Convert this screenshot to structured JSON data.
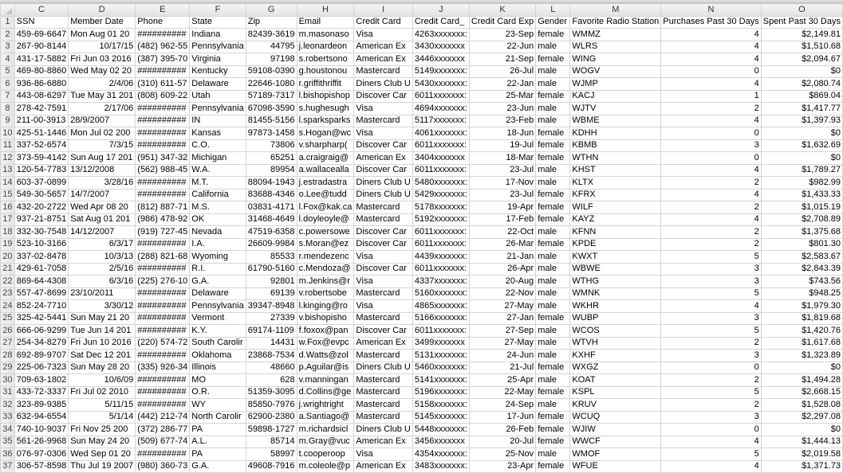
{
  "sheet": {
    "column_letters": [
      "C",
      "D",
      "E",
      "F",
      "G",
      "H",
      "I",
      "J",
      "K",
      "L",
      "M",
      "N",
      "O"
    ],
    "header_row": [
      "SSN",
      "Member Date",
      "Phone",
      "State",
      "Zip",
      "Email",
      "Credit Card",
      "Credit Card_",
      "Credit Card Exp",
      "Gender",
      "Favorite Radio Station",
      "Purchases Past 30 Days",
      "Spent Past 30 Days"
    ],
    "rows": [
      [
        "459-69-6647",
        "Mon Aug 01 20",
        "##########",
        "Indiana",
        "82439-3619",
        "m.masonaso",
        "Visa",
        "4263xxxxxxx:",
        "23-Sep",
        "female",
        "WMMZ",
        "4",
        "$2,149.81"
      ],
      [
        "267-90-8144",
        "10/17/15",
        "(482) 962-55",
        "Pennsylvania",
        "44795",
        "j.leonardeon",
        "American Ex",
        "3430xxxxxxx",
        "22-Jun",
        "male",
        "WLRS",
        "4",
        "$1,510.68"
      ],
      [
        "431-17-5882",
        "Fri Jun 03 2016",
        "(387) 395-70",
        "Virginia",
        "97198",
        "s.robertsono",
        "American Ex",
        "3446xxxxxxx",
        "21-Sep",
        "female",
        "WING",
        "4",
        "$2,094.67"
      ],
      [
        "469-80-8860",
        "Wed May 02 20",
        "##########",
        "Kentucky",
        "59108-0390",
        "g.houstonou",
        "Mastercard",
        "5149xxxxxxx:",
        "26-Jul",
        "male",
        "WOGV",
        "0",
        "$0"
      ],
      [
        "936-86-6880",
        "2/4/06",
        "(310) 611-57",
        "Delaware",
        "22646-1080",
        "r.griffithriffit",
        "Diners Club U",
        "5430xxxxxxx:",
        "22-Jan",
        "male",
        "WJMP",
        "4",
        "$2,080.74"
      ],
      [
        "443-08-6297",
        "Tue May 31 201",
        "(808) 609-22",
        "Utah",
        "57189-7317",
        "l.bishopishop",
        "Discover Car",
        "6011xxxxxxx:",
        "25-Mar",
        "female",
        "KACJ",
        "1",
        "$869.04"
      ],
      [
        "278-42-7591",
        "2/17/06",
        "##########",
        "Pennsylvania",
        "67098-3590",
        "s.hughesugh",
        "Visa",
        "4694xxxxxxx:",
        "23-Jun",
        "male",
        "WJTV",
        "2",
        "$1,417.77"
      ],
      [
        "211-00-3913",
        "28/9/2007",
        "##########",
        "IN",
        "81455-5156",
        "l.sparksparks",
        "Mastercard",
        "5117xxxxxxx:",
        "23-Feb",
        "male",
        "WBME",
        "4",
        "$1,397.93"
      ],
      [
        "425-51-1446",
        "Mon Jul 02 200",
        "##########",
        "Kansas",
        "97873-1458",
        "s.Hogan@wc",
        "Visa",
        "4061xxxxxxx:",
        "18-Jun",
        "female",
        "KDHH",
        "0",
        "$0"
      ],
      [
        "337-52-6574",
        "7/3/15",
        "##########",
        "C.O.",
        "73806",
        "v.sharpharp(",
        "Discover Car",
        "6011xxxxxxx:",
        "19-Jul",
        "female",
        "KBMB",
        "3",
        "$1,632.69"
      ],
      [
        "373-59-4142",
        "Sun Aug 17 201",
        "(951) 347-32",
        "Michigan",
        "65251",
        "a.craigraig@",
        "American Ex",
        "3404xxxxxxx",
        "18-Mar",
        "female",
        "WTHN",
        "0",
        "$0"
      ],
      [
        "120-54-7783",
        "13/12/2008",
        "(562) 988-45",
        "W.A.",
        "89954",
        "a.wallacealla",
        "Discover Car",
        "6011xxxxxxx:",
        "23-Jul",
        "male",
        "KHST",
        "4",
        "$1,789.27"
      ],
      [
        "603-37-0899",
        "3/28/16",
        "##########",
        "M.T.",
        "88094-1943",
        "j.estradastra",
        "Diners Club U",
        "5480xxxxxxx:",
        "17-Nov",
        "male",
        "KLTX",
        "2",
        "$982.99"
      ],
      [
        "549-30-5657",
        "14/7/2007",
        "##########",
        "California",
        "83688-4346",
        "o.Lee@tudd",
        "Diners Club U",
        "5429xxxxxxx:",
        "23-Jul",
        "female",
        "KFRX",
        "4",
        "$1,433.33"
      ],
      [
        "432-20-2722",
        "Wed Apr 08 20",
        "(812) 887-71",
        "M.S.",
        "03831-4171",
        "l.Fox@kak.ca",
        "Mastercard",
        "5178xxxxxxx:",
        "19-Apr",
        "female",
        "WILF",
        "2",
        "$1,015.19"
      ],
      [
        "937-21-8751",
        "Sat Aug 01 201",
        "(986) 478-92",
        "OK",
        "31468-4649",
        "l.doyleoyle@",
        "Mastercard",
        "5192xxxxxxx:",
        "17-Feb",
        "female",
        "KAYZ",
        "4",
        "$2,708.89"
      ],
      [
        "332-30-7548",
        "14/12/2007",
        "(919) 727-45",
        "Nevada",
        "47519-6358",
        "c.powersowe",
        "Discover Car",
        "6011xxxxxxx:",
        "22-Oct",
        "male",
        "KFNN",
        "2",
        "$1,375.68"
      ],
      [
        "523-10-3166",
        "6/3/17",
        "##########",
        "I.A.",
        "26609-9984",
        "s.Moran@ez",
        "Discover Car",
        "6011xxxxxxx:",
        "26-Mar",
        "female",
        "KPDE",
        "2",
        "$801.30"
      ],
      [
        "337-02-8478",
        "10/3/13",
        "(288) 821-68",
        "Wyoming",
        "85533",
        "r.mendezenc",
        "Visa",
        "4439xxxxxxx:",
        "21-Jan",
        "male",
        "KWXT",
        "5",
        "$2,583.67"
      ],
      [
        "429-61-7058",
        "2/5/16",
        "##########",
        "R.I.",
        "61790-5160",
        "c.Mendoza@",
        "Discover Car",
        "6011xxxxxxx:",
        "26-Apr",
        "male",
        "WBWE",
        "3",
        "$2,843.39"
      ],
      [
        "869-64-4308",
        "6/3/16",
        "(225) 276-10",
        "G.A.",
        "92801",
        "m.Jenkins@r",
        "Visa",
        "4337xxxxxxx:",
        "20-Aug",
        "male",
        "WTHG",
        "3",
        "$743.56"
      ],
      [
        "557-47-8699",
        "23/10/2011",
        "##########",
        "Delaware",
        "69139",
        "v.robertsobe",
        "Mastercard",
        "5160xxxxxxx:",
        "22-Nov",
        "male",
        "WMNK",
        "5",
        "$948.25"
      ],
      [
        "852-24-7710",
        "3/30/12",
        "##########",
        "Pennsylvania",
        "39347-8948",
        "l.kinging@ro",
        "Visa",
        "4865xxxxxxx:",
        "27-May",
        "male",
        "WKHR",
        "4",
        "$1,979.30"
      ],
      [
        "325-42-5441",
        "Sun May 21 20",
        "##########",
        "Vermont",
        "27339",
        "v.bishopisho",
        "Mastercard",
        "5166xxxxxxx:",
        "27-Jan",
        "female",
        "WUBP",
        "3",
        "$1,819.68"
      ],
      [
        "666-06-9299",
        "Tue Jun 14 201",
        "##########",
        "K.Y.",
        "69174-1109",
        "f.foxox@pan",
        "Discover Car",
        "6011xxxxxxx:",
        "27-Sep",
        "male",
        "WCOS",
        "5",
        "$1,420.76"
      ],
      [
        "254-34-8279",
        "Fri Jun 10 2016",
        "(220) 574-72",
        "South Carolir",
        "14431",
        "w.Fox@evpc",
        "American Ex",
        "3499xxxxxxx",
        "27-May",
        "male",
        "WTVH",
        "2",
        "$1,617.68"
      ],
      [
        "692-89-9707",
        "Sat Dec 12 201",
        "##########",
        "Oklahoma",
        "23868-7534",
        "d.Watts@zol",
        "Mastercard",
        "5131xxxxxxx:",
        "24-Jun",
        "male",
        "KXHF",
        "3",
        "$1,323.89"
      ],
      [
        "225-06-7323",
        "Sun May 28 20",
        "(335) 926-34",
        "Illinois",
        "48660",
        "p.Aguilar@is",
        "Diners Club U",
        "5460xxxxxxx:",
        "21-Jul",
        "female",
        "WXGZ",
        "0",
        "$0"
      ],
      [
        "709-63-1802",
        "10/6/09",
        "##########",
        "MO",
        "628",
        "v.manningan",
        "Mastercard",
        "5141xxxxxxx:",
        "25-Apr",
        "male",
        "KOAT",
        "2",
        "$1,494.28"
      ],
      [
        "433-72-3337",
        "Fri Jul 02 2010",
        "##########",
        "O.R.",
        "51359-3095",
        "d.Collins@ge",
        "Mastercard",
        "5196xxxxxxx:",
        "22-May",
        "female",
        "KSPL",
        "5",
        "$2,668.15"
      ],
      [
        "323-89-9385",
        "5/11/15",
        "##########",
        "WY",
        "85850-7976",
        "j.wrightright",
        "Mastercard",
        "5158xxxxxxx:",
        "24-Sep",
        "male",
        "KRUV",
        "2",
        "$1,528.08"
      ],
      [
        "632-94-6554",
        "5/1/14",
        "(442) 212-74",
        "North Carolir",
        "62900-2380",
        "a.Santiago@",
        "Mastercard",
        "5145xxxxxxx:",
        "17-Jun",
        "female",
        "WCUQ",
        "3",
        "$2,297.08"
      ],
      [
        "740-10-9037",
        "Fri Nov 25 200",
        "(372) 286-77",
        "PA",
        "59898-1727",
        "m.richardsicl",
        "Diners Club U",
        "5448xxxxxxx:",
        "26-Feb",
        "female",
        "WJIW",
        "0",
        "$0"
      ],
      [
        "561-26-9968",
        "Sun May 24 20",
        "(509) 677-74",
        "A.L.",
        "85714",
        "m.Gray@vuc",
        "American Ex",
        "3456xxxxxxx",
        "20-Jul",
        "female",
        "WWCF",
        "4",
        "$1,444.13"
      ],
      [
        "076-97-0306",
        "Wed Sep 01 20",
        "##########",
        "PA",
        "58997",
        "t.cooperoop",
        "Visa",
        "4354xxxxxxx:",
        "25-Nov",
        "male",
        "WMOF",
        "5",
        "$2,019.58"
      ],
      [
        "306-57-8598",
        "Thu Jul 19 2007",
        "(980) 360-73",
        "G.A.",
        "49608-7916",
        "m.coleole@p",
        "American Ex",
        "3483xxxxxxx:",
        "23-Apr",
        "female",
        "WFUE",
        "4",
        "$1,371.73"
      ]
    ],
    "right_aligned_cols_by_row": "see script"
  }
}
